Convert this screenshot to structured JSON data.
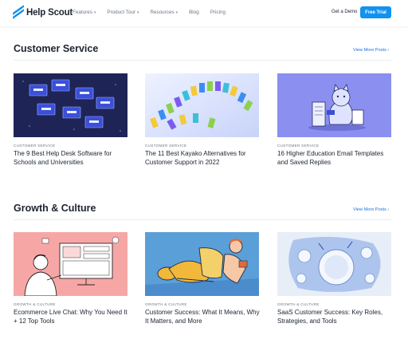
{
  "header": {
    "logo_text": "Help Scout",
    "nav": [
      {
        "label": "Features",
        "has_dropdown": true
      },
      {
        "label": "Product Tour",
        "has_dropdown": true
      },
      {
        "label": "Resources",
        "has_dropdown": true
      },
      {
        "label": "Blog",
        "has_dropdown": false
      },
      {
        "label": "Pricing",
        "has_dropdown": false
      }
    ],
    "get_demo": "Get a Demo",
    "free_trial": "Free Trial"
  },
  "colors": {
    "brand_blue": "#1292ee",
    "link_blue": "#1a73d9",
    "card1_bg": "#1f2456",
    "card3_bg": "#8a8ff0",
    "card4_bg": "#f6a7a5",
    "card5_bg": "#5b9fd8",
    "card6_bg": "#e7eef8"
  },
  "sections": [
    {
      "title": "Customer Service",
      "view_more": "View More Posts ›",
      "cards": [
        {
          "category": "CUSTOMER SERVICE",
          "title": "The 9 Best Help Desk Software for Schools and Universities",
          "image_icon": "filing-drawers-illustration"
        },
        {
          "category": "CUSTOMER SERVICE",
          "title": "The 11 Best Kayako Alternatives for Customer Support in 2022",
          "image_icon": "colorful-blocks-illustration"
        },
        {
          "category": "CUSTOMER SERVICE",
          "title": "16 Higher Education Email Templates and Saved Replies",
          "image_icon": "cat-with-documents-illustration"
        }
      ]
    },
    {
      "title": "Growth & Culture",
      "view_more": "View More Posts ›",
      "cards": [
        {
          "category": "GROWTH & CULTURE",
          "title": "Ecommerce Live Chat: Why You Need It + 12 Top Tools",
          "image_icon": "person-at-computer-illustration"
        },
        {
          "category": "GROWTH & CULTURE",
          "title": "Customer Success: What It Means, Why It Matters, and More",
          "image_icon": "people-sitting-illustration"
        },
        {
          "category": "GROWTH & CULTURE",
          "title": "SaaS Customer Success: Key Roles, Strategies, and Tools",
          "image_icon": "plates-table-illustration"
        }
      ]
    }
  ]
}
